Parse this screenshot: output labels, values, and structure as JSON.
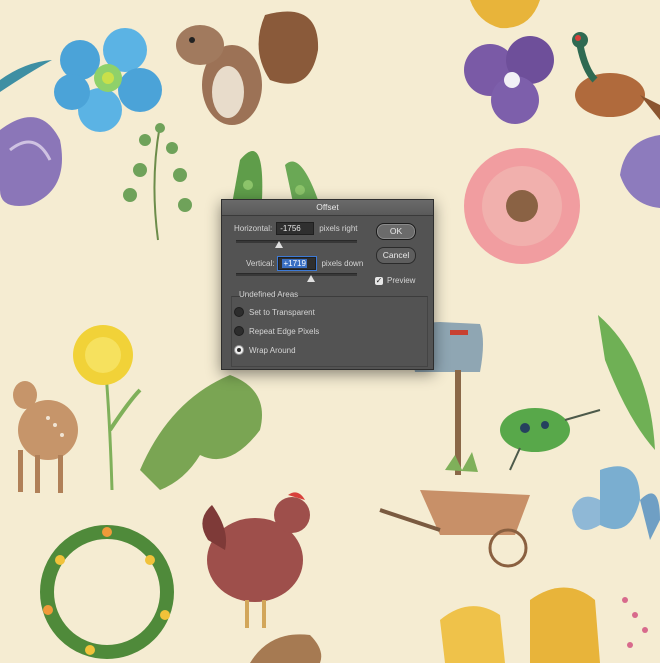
{
  "dialog": {
    "title": "Offset",
    "horizontal": {
      "label": "Horizontal:",
      "value": "-1756",
      "unit": "pixels right"
    },
    "vertical": {
      "label": "Vertical:",
      "value": "+1719",
      "unit": "pixels down"
    },
    "ok_label": "OK",
    "cancel_label": "Cancel",
    "preview": {
      "label": "Preview",
      "checked": true
    },
    "undefined_areas": {
      "title": "Undefined Areas",
      "options": [
        {
          "label": "Set to Transparent",
          "selected": false
        },
        {
          "label": "Repeat Edge Pixels",
          "selected": false
        },
        {
          "label": "Wrap Around",
          "selected": true
        }
      ]
    }
  },
  "icons": {
    "checkmark": "✓"
  },
  "colors": {
    "canvas_background": "#f5ecd2",
    "dialog_background": "#535353",
    "accent": "#3a6fc2"
  }
}
